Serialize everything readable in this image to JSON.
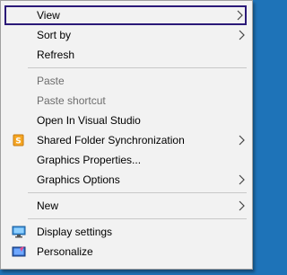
{
  "menu": {
    "items": [
      {
        "label": "View",
        "submenu": true
      },
      {
        "label": "Sort by",
        "submenu": true
      },
      {
        "label": "Refresh",
        "submenu": false
      },
      {
        "label": "Paste",
        "disabled": true
      },
      {
        "label": "Paste shortcut",
        "disabled": true
      },
      {
        "label": "Open In Visual Studio"
      },
      {
        "label": "Shared Folder Synchronization",
        "submenu": true,
        "icon": "shared-folder-sync-icon"
      },
      {
        "label": "Graphics Properties..."
      },
      {
        "label": "Graphics Options",
        "submenu": true
      },
      {
        "label": "New",
        "submenu": true
      },
      {
        "label": "Display settings",
        "icon": "display-settings-icon"
      },
      {
        "label": "Personalize",
        "icon": "personalize-icon"
      }
    ]
  },
  "colors": {
    "menu_bg": "#f2f2f2",
    "highlight_border": "#2b1a78",
    "disabled_text": "#6d6d6d",
    "desktop_bg": "#1e73b8"
  }
}
